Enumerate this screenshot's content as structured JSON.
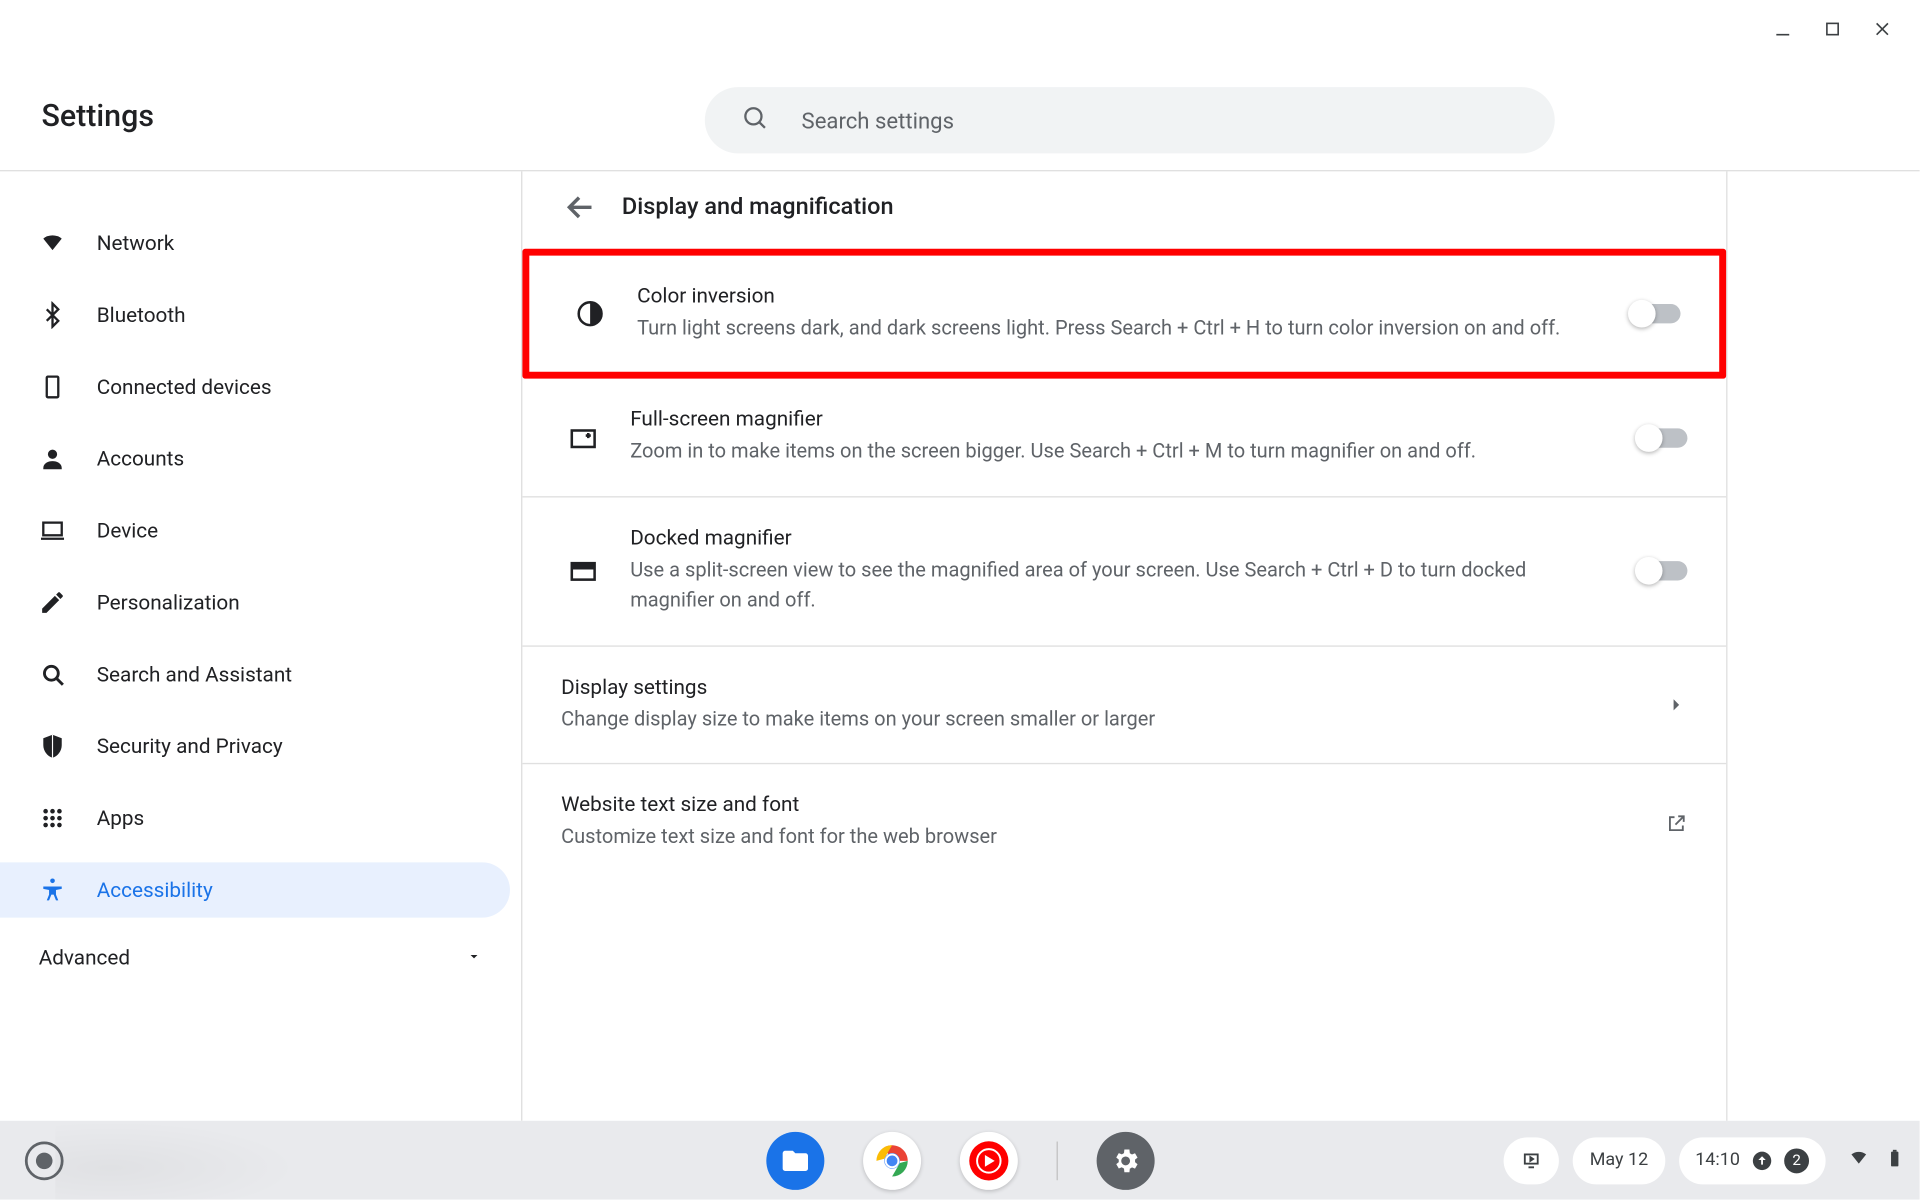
{
  "app_title": "Settings",
  "search": {
    "placeholder": "Search settings"
  },
  "sidebar": {
    "items": [
      {
        "label": "Network"
      },
      {
        "label": "Bluetooth"
      },
      {
        "label": "Connected devices"
      },
      {
        "label": "Accounts"
      },
      {
        "label": "Device"
      },
      {
        "label": "Personalization"
      },
      {
        "label": "Search and Assistant"
      },
      {
        "label": "Security and Privacy"
      },
      {
        "label": "Apps"
      },
      {
        "label": "Accessibility"
      }
    ],
    "advanced_label": "Advanced"
  },
  "page": {
    "title": "Display and magnification",
    "rows": [
      {
        "title": "Color inversion",
        "desc": "Turn light screens dark, and dark screens light. Press Search + Ctrl + H to turn color inversion on and off.",
        "highlighted": true
      },
      {
        "title": "Full-screen magnifier",
        "desc": "Zoom in to make items on the screen bigger. Use Search + Ctrl + M to turn magnifier on and off."
      },
      {
        "title": "Docked magnifier",
        "desc": "Use a split-screen view to see the magnified area of your screen. Use Search + Ctrl + D to turn docked magnifier on and off."
      },
      {
        "title": "Display settings",
        "desc": "Change display size to make items on your screen smaller or larger"
      },
      {
        "title": "Website text size and font",
        "desc": "Customize text size and font for the web browser"
      }
    ]
  },
  "tray": {
    "date": "May 12",
    "time": "14:10",
    "notification_count": "2"
  }
}
